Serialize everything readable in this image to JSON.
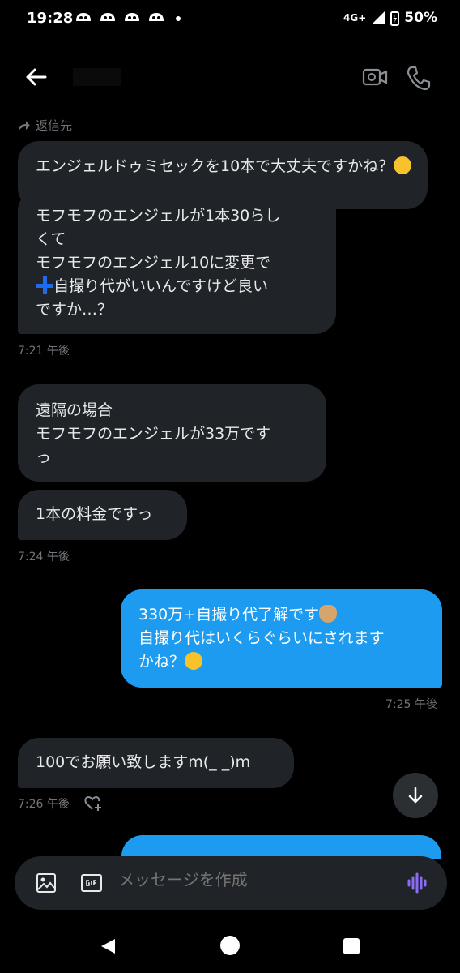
{
  "status_bar": {
    "time": "19:28",
    "network": "4G+",
    "battery": "50%"
  },
  "header": {
    "icons": [
      "back-arrow-icon",
      "video-call-icon",
      "phone-icon"
    ]
  },
  "reply": {
    "label": "返信先"
  },
  "messages": [
    {
      "dir": "in",
      "quoted": true,
      "text": "エンジェルドゥミセックを10本で大丈夫ですかね？"
    },
    {
      "dir": "in",
      "lines": [
        "モフモフのエンジェルが1本30らし",
        "くて",
        "モフモフのエンジェル10に変更で",
        "自撮り代がいいんですけど良い",
        "ですか…？"
      ]
    },
    {
      "dir": "in",
      "lines": [
        "遠隔の場合",
        "モフモフのエンジェルが33万です",
        "っ"
      ]
    },
    {
      "dir": "in",
      "text": "1本の料金ですっ"
    },
    {
      "dir": "out",
      "lines": [
        "330万+自撮り代了解です",
        "自撮り代はいくらぐらいにされます",
        "かね？"
      ]
    },
    {
      "dir": "in",
      "text": "100でお願い致しますm(_ _)m"
    }
  ],
  "times": [
    "7:21 午後",
    "7:24 午後",
    "7:25 午後",
    "7:26 午後"
  ],
  "composer": {
    "placeholder": "メッセージを作成"
  },
  "colors": {
    "accent": "#1d9bf0",
    "bubble_in": "#202327",
    "background": "#000000"
  }
}
